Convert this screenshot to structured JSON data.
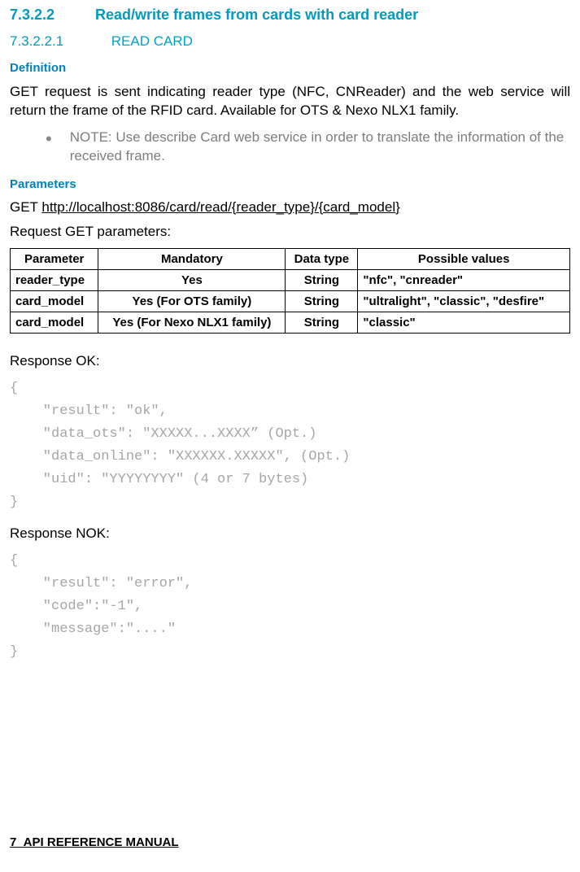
{
  "headings": {
    "h7_3_2_2_num": "7.3.2.2",
    "h7_3_2_2_text": "Read/write frames from cards with card reader",
    "h7_3_2_2_1_num": "7.3.2.2.1",
    "h7_3_2_2_1_text": "READ CARD",
    "definition": "Definition",
    "parameters": "Parameters"
  },
  "definition_body": "GET request is sent indicating reader type (NFC, CNReader) and the web service will return the frame of the RFID card. Available for OTS & Nexo NLX1 family.",
  "note": "NOTE: Use describe Card web service in order to translate the information of the received frame.",
  "get_label": "GET ",
  "get_url": "http://localhost:8086/card/read/{reader_type}/{card_model}",
  "req_params_label": "Request GET parameters:",
  "table": {
    "headers": [
      "Parameter",
      "Mandatory",
      "Data type",
      "Possible values"
    ],
    "rows": [
      {
        "param": "reader_type",
        "mandatory": "Yes",
        "dtype": "String",
        "pvals": "\"nfc\", \"cnreader\""
      },
      {
        "param": "card_model",
        "mandatory": "Yes (For OTS family)",
        "dtype": "String",
        "pvals": "\"ultralight\", \"classic\", \"desfire\""
      },
      {
        "param": "card_model",
        "mandatory": "Yes (For Nexo NLX1 family)",
        "dtype": "String",
        "pvals": "\"classic\""
      }
    ]
  },
  "response_ok_label": "Response OK:",
  "response_ok_code": "{\n    \"result\": \"ok\",\n    \"data_ots\": \"XXXXX...XXXX” (Opt.)\n    \"data_online\": \"XXXXXX.XXXXX\", (Opt.)\n    \"uid\": \"YYYYYYYY\" (4 or 7 bytes)\n}",
  "response_nok_label": "Response NOK:",
  "response_nok_code": "{\n    \"result\": \"error\",\n    \"code\":\"-1\",\n    \"message\":\"....\"\n}",
  "footer": "7_API REFERENCE MANUAL"
}
